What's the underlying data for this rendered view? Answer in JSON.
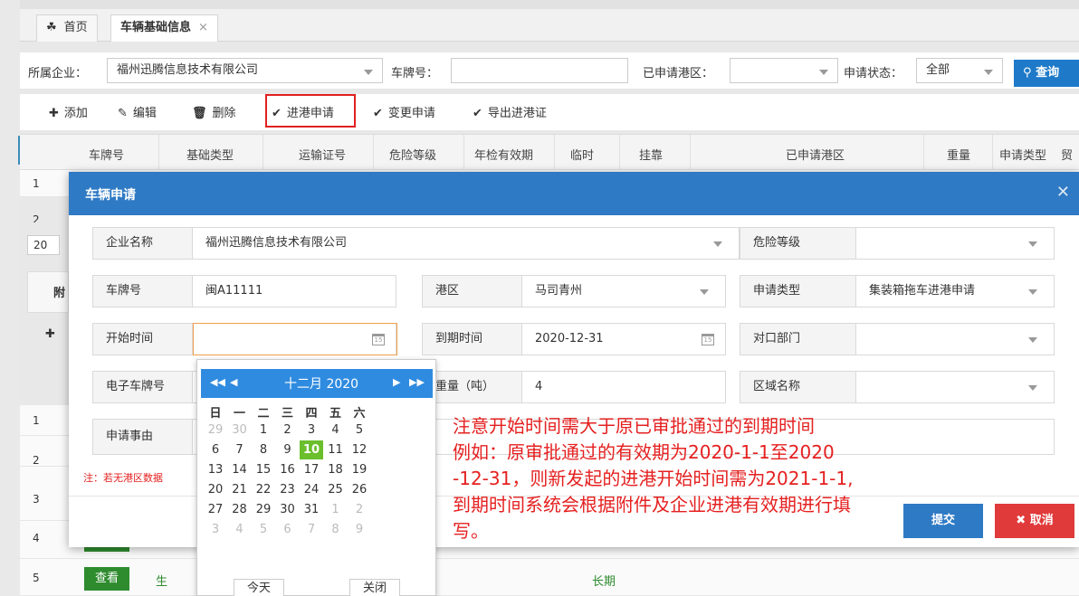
{
  "tabs": [
    {
      "label": "首页"
    },
    {
      "label": "车辆基础信息"
    }
  ],
  "search": {
    "company_label": "所属企业：",
    "company_value": "福州迅腾信息技术有限公司",
    "plate_label": "车牌号：",
    "plate_value": "",
    "port_label": "已申请港区：",
    "port_value": "",
    "status_label": "申请状态：",
    "status_value": "全部",
    "query_label": "查询"
  },
  "toolbar": {
    "add": "添加",
    "edit": "编辑",
    "delete": "删除",
    "apply": "进港申请",
    "change": "变更申请",
    "export": "导出进港证"
  },
  "grid": {
    "headers": [
      "车牌号",
      "基础类型",
      "运输证号",
      "危险等级",
      "年检有效期",
      "临时",
      "挂靠",
      "已申请港区",
      "重量",
      "申请类型",
      "贸"
    ],
    "row_numbers": [
      "1",
      "2",
      "1",
      "2",
      "3",
      "4",
      "5"
    ],
    "page_size": "20",
    "section_tab": "附",
    "row5_btn": "查看",
    "row5_text": "生",
    "row5_period": "长期"
  },
  "modal": {
    "title": "车辆申请",
    "fields": {
      "company_label": "企业名称",
      "company_value": "福州迅腾信息技术有限公司",
      "danger_label": "危险等级",
      "danger_value": "",
      "plate_label": "车牌号",
      "plate_value": "闽A11111",
      "port_label": "港区",
      "port_value": "马司青州",
      "type_label": "申请类型",
      "type_value": "集装箱拖车进港申请",
      "start_label": "开始时间",
      "start_value": "",
      "end_label": "到期时间",
      "end_value": "2020-12-31",
      "dept_label": "对口部门",
      "dept_value": "",
      "eplate_label": "电子车牌号",
      "weight_label": "重量（吨）",
      "weight_value": "4",
      "region_label": "区域名称",
      "region_value": "",
      "reason_label": "申请事由"
    },
    "note": "注：若无港区数据",
    "save": "提交",
    "cancel": "取消"
  },
  "calendar": {
    "month_title": "十二月 2020",
    "weekdays": [
      "日",
      "一",
      "二",
      "三",
      "四",
      "五",
      "六"
    ],
    "weeks": [
      [
        "29",
        "30",
        "1",
        "2",
        "3",
        "4",
        "5"
      ],
      [
        "6",
        "7",
        "8",
        "9",
        "10",
        "11",
        "12"
      ],
      [
        "13",
        "14",
        "15",
        "16",
        "17",
        "18",
        "19"
      ],
      [
        "20",
        "21",
        "22",
        "23",
        "24",
        "25",
        "26"
      ],
      [
        "27",
        "28",
        "29",
        "30",
        "31",
        "1",
        "2"
      ],
      [
        "3",
        "4",
        "5",
        "6",
        "7",
        "8",
        "9"
      ]
    ],
    "today": "10",
    "today_btn": "今天",
    "close_btn": "关闭"
  },
  "annotation": [
    "注意开始时间需大于原已审批通过的到期时间",
    "例如：原审批通过的有效期为2020-1-1至2020",
    "-12-31，则新发起的进港开始时间需为2021-1-1,",
    "到期时间系统会根据附件及企业进港有效期进行填",
    "写。"
  ],
  "colors": {
    "primary": "#2f7ac4",
    "danger": "#e03a3a",
    "highlight": "#e02020",
    "today": "#6bbf2d"
  }
}
